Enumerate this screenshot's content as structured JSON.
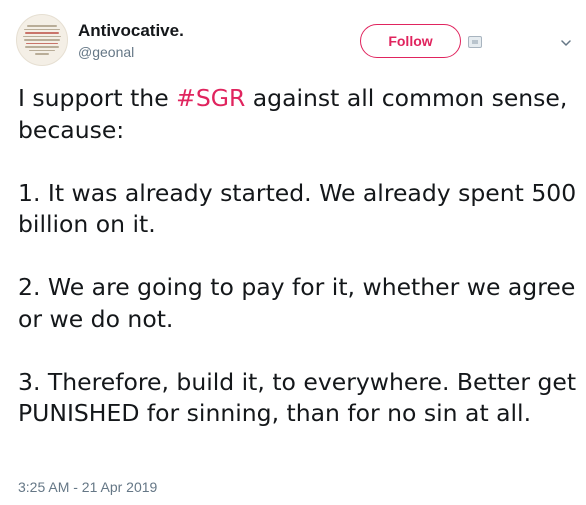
{
  "author": {
    "display_name": "Antivocative.",
    "handle": "@geonal"
  },
  "follow_button": {
    "label": "Follow",
    "accent_color": "#e0245e"
  },
  "tweet": {
    "line1_prefix": "I support the ",
    "hashtag": "#SGR",
    "line1_suffix": " against all common sense, because:",
    "point1": "1. It was already started. We already spent 500 billion on it.",
    "point2": "2. We are going to pay for it, whether we agree or we do not.",
    "point3": "3. Therefore, build it, to everywhere. Better get PUNISHED for sinning, than for no sin at all.",
    "timestamp": "3:25 AM - 21 Apr 2019"
  },
  "icons": {
    "avatar": "avatar-text-image",
    "menu": "chevron-down-icon",
    "follow_extra": "small-badge-icon"
  },
  "colors": {
    "text": "#14171a",
    "secondary": "#657786",
    "hashtag": "#e0245e"
  }
}
